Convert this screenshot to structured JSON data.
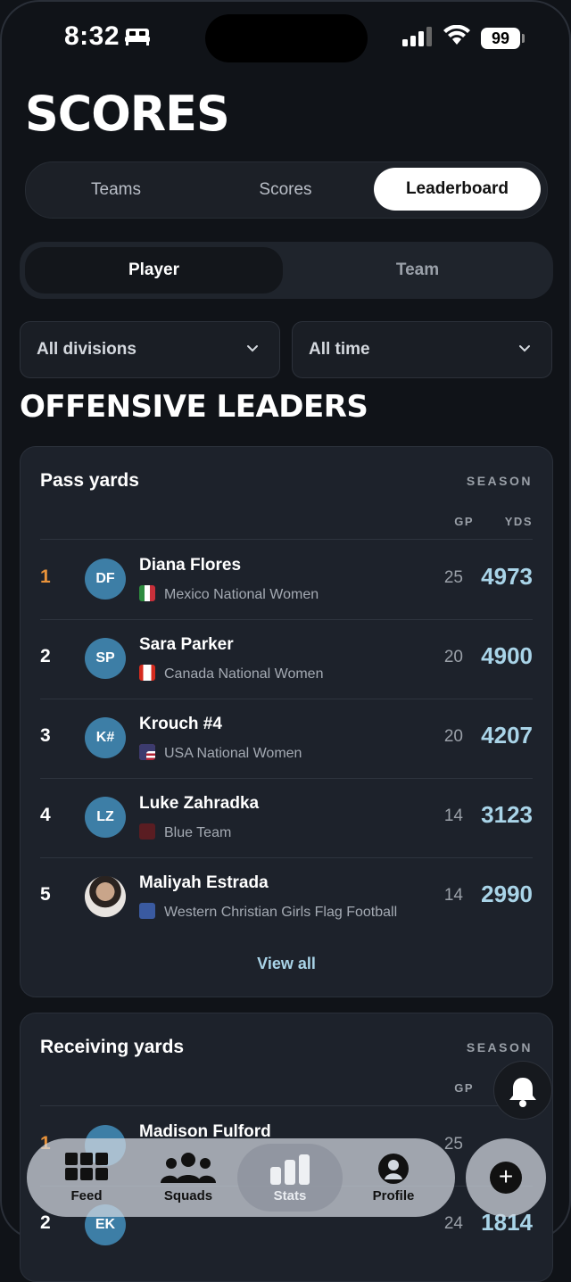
{
  "status": {
    "time": "8:32",
    "battery": "99"
  },
  "page_title": "SCORES",
  "main_tabs": [
    {
      "label": "Teams",
      "active": false
    },
    {
      "label": "Scores",
      "active": false
    },
    {
      "label": "Leaderboard",
      "active": true
    }
  ],
  "sub_tabs": [
    {
      "label": "Player",
      "active": true
    },
    {
      "label": "Team",
      "active": false
    }
  ],
  "filters": {
    "division": "All divisions",
    "period": "All time"
  },
  "section_title": "OFFENSIVE LEADERS",
  "pass_card": {
    "title": "Pass yards",
    "period": "SEASON",
    "col_gp": "GP",
    "col_yds": "YDS",
    "view_all": "View all",
    "rows": [
      {
        "rank": "1",
        "initials": "DF",
        "name": "Diana  Flores",
        "team": "Mexico National Women",
        "gp": "25",
        "yds": "4973"
      },
      {
        "rank": "2",
        "initials": "SP",
        "name": "Sara Parker",
        "team": "Canada National Women",
        "gp": "20",
        "yds": "4900"
      },
      {
        "rank": "3",
        "initials": "K#",
        "name": "Krouch #4",
        "team": "USA National Women",
        "gp": "20",
        "yds": "4207"
      },
      {
        "rank": "4",
        "initials": "LZ",
        "name": "Luke Zahradka",
        "team": "Blue Team",
        "gp": "14",
        "yds": "3123"
      },
      {
        "rank": "5",
        "initials": "",
        "name": "Maliyah Estrada",
        "team": "Western Christian Girls Flag Football",
        "gp": "14",
        "yds": "2990"
      }
    ]
  },
  "recv_card": {
    "title": "Receiving yards",
    "period": "SEASON",
    "col_gp": "GP",
    "rows": [
      {
        "rank": "1",
        "initials": "",
        "name": "Madison  Fulford",
        "team": "",
        "gp": "25",
        "yds": ""
      },
      {
        "rank": "2",
        "initials": "EK",
        "name": "",
        "team": "",
        "gp": "24",
        "yds": "1814"
      }
    ]
  },
  "nav": [
    {
      "label": "Feed",
      "icon": "grid-icon"
    },
    {
      "label": "Squads",
      "icon": "people-icon"
    },
    {
      "label": "Stats",
      "icon": "bar-chart-icon",
      "active": true
    },
    {
      "label": "Profile",
      "icon": "person-icon"
    }
  ],
  "colors": {
    "accent": "#a9d4e8",
    "gold": "#e8923a",
    "avatar": "#3d7ea6"
  }
}
